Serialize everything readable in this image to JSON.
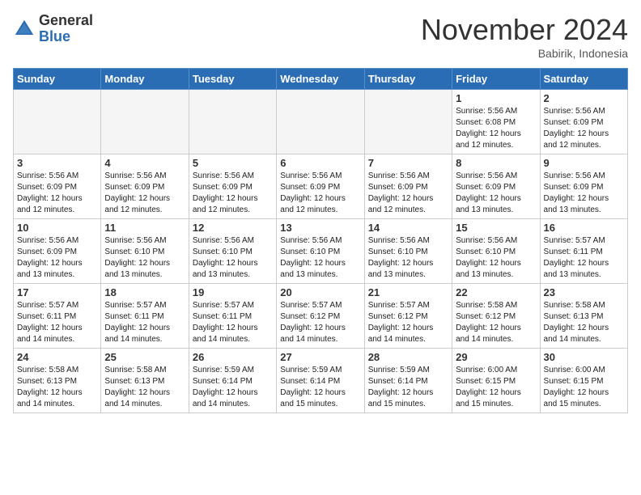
{
  "header": {
    "logo_general": "General",
    "logo_blue": "Blue",
    "month": "November 2024",
    "location": "Babirik, Indonesia"
  },
  "weekdays": [
    "Sunday",
    "Monday",
    "Tuesday",
    "Wednesday",
    "Thursday",
    "Friday",
    "Saturday"
  ],
  "weeks": [
    [
      {
        "day": "",
        "info": ""
      },
      {
        "day": "",
        "info": ""
      },
      {
        "day": "",
        "info": ""
      },
      {
        "day": "",
        "info": ""
      },
      {
        "day": "",
        "info": ""
      },
      {
        "day": "1",
        "info": "Sunrise: 5:56 AM\nSunset: 6:08 PM\nDaylight: 12 hours and 12 minutes."
      },
      {
        "day": "2",
        "info": "Sunrise: 5:56 AM\nSunset: 6:09 PM\nDaylight: 12 hours and 12 minutes."
      }
    ],
    [
      {
        "day": "3",
        "info": "Sunrise: 5:56 AM\nSunset: 6:09 PM\nDaylight: 12 hours and 12 minutes."
      },
      {
        "day": "4",
        "info": "Sunrise: 5:56 AM\nSunset: 6:09 PM\nDaylight: 12 hours and 12 minutes."
      },
      {
        "day": "5",
        "info": "Sunrise: 5:56 AM\nSunset: 6:09 PM\nDaylight: 12 hours and 12 minutes."
      },
      {
        "day": "6",
        "info": "Sunrise: 5:56 AM\nSunset: 6:09 PM\nDaylight: 12 hours and 12 minutes."
      },
      {
        "day": "7",
        "info": "Sunrise: 5:56 AM\nSunset: 6:09 PM\nDaylight: 12 hours and 12 minutes."
      },
      {
        "day": "8",
        "info": "Sunrise: 5:56 AM\nSunset: 6:09 PM\nDaylight: 12 hours and 13 minutes."
      },
      {
        "day": "9",
        "info": "Sunrise: 5:56 AM\nSunset: 6:09 PM\nDaylight: 12 hours and 13 minutes."
      }
    ],
    [
      {
        "day": "10",
        "info": "Sunrise: 5:56 AM\nSunset: 6:09 PM\nDaylight: 12 hours and 13 minutes."
      },
      {
        "day": "11",
        "info": "Sunrise: 5:56 AM\nSunset: 6:10 PM\nDaylight: 12 hours and 13 minutes."
      },
      {
        "day": "12",
        "info": "Sunrise: 5:56 AM\nSunset: 6:10 PM\nDaylight: 12 hours and 13 minutes."
      },
      {
        "day": "13",
        "info": "Sunrise: 5:56 AM\nSunset: 6:10 PM\nDaylight: 12 hours and 13 minutes."
      },
      {
        "day": "14",
        "info": "Sunrise: 5:56 AM\nSunset: 6:10 PM\nDaylight: 12 hours and 13 minutes."
      },
      {
        "day": "15",
        "info": "Sunrise: 5:56 AM\nSunset: 6:10 PM\nDaylight: 12 hours and 13 minutes."
      },
      {
        "day": "16",
        "info": "Sunrise: 5:57 AM\nSunset: 6:11 PM\nDaylight: 12 hours and 13 minutes."
      }
    ],
    [
      {
        "day": "17",
        "info": "Sunrise: 5:57 AM\nSunset: 6:11 PM\nDaylight: 12 hours and 14 minutes."
      },
      {
        "day": "18",
        "info": "Sunrise: 5:57 AM\nSunset: 6:11 PM\nDaylight: 12 hours and 14 minutes."
      },
      {
        "day": "19",
        "info": "Sunrise: 5:57 AM\nSunset: 6:11 PM\nDaylight: 12 hours and 14 minutes."
      },
      {
        "day": "20",
        "info": "Sunrise: 5:57 AM\nSunset: 6:12 PM\nDaylight: 12 hours and 14 minutes."
      },
      {
        "day": "21",
        "info": "Sunrise: 5:57 AM\nSunset: 6:12 PM\nDaylight: 12 hours and 14 minutes."
      },
      {
        "day": "22",
        "info": "Sunrise: 5:58 AM\nSunset: 6:12 PM\nDaylight: 12 hours and 14 minutes."
      },
      {
        "day": "23",
        "info": "Sunrise: 5:58 AM\nSunset: 6:13 PM\nDaylight: 12 hours and 14 minutes."
      }
    ],
    [
      {
        "day": "24",
        "info": "Sunrise: 5:58 AM\nSunset: 6:13 PM\nDaylight: 12 hours and 14 minutes."
      },
      {
        "day": "25",
        "info": "Sunrise: 5:58 AM\nSunset: 6:13 PM\nDaylight: 12 hours and 14 minutes."
      },
      {
        "day": "26",
        "info": "Sunrise: 5:59 AM\nSunset: 6:14 PM\nDaylight: 12 hours and 14 minutes."
      },
      {
        "day": "27",
        "info": "Sunrise: 5:59 AM\nSunset: 6:14 PM\nDaylight: 12 hours and 15 minutes."
      },
      {
        "day": "28",
        "info": "Sunrise: 5:59 AM\nSunset: 6:14 PM\nDaylight: 12 hours and 15 minutes."
      },
      {
        "day": "29",
        "info": "Sunrise: 6:00 AM\nSunset: 6:15 PM\nDaylight: 12 hours and 15 minutes."
      },
      {
        "day": "30",
        "info": "Sunrise: 6:00 AM\nSunset: 6:15 PM\nDaylight: 12 hours and 15 minutes."
      }
    ]
  ]
}
